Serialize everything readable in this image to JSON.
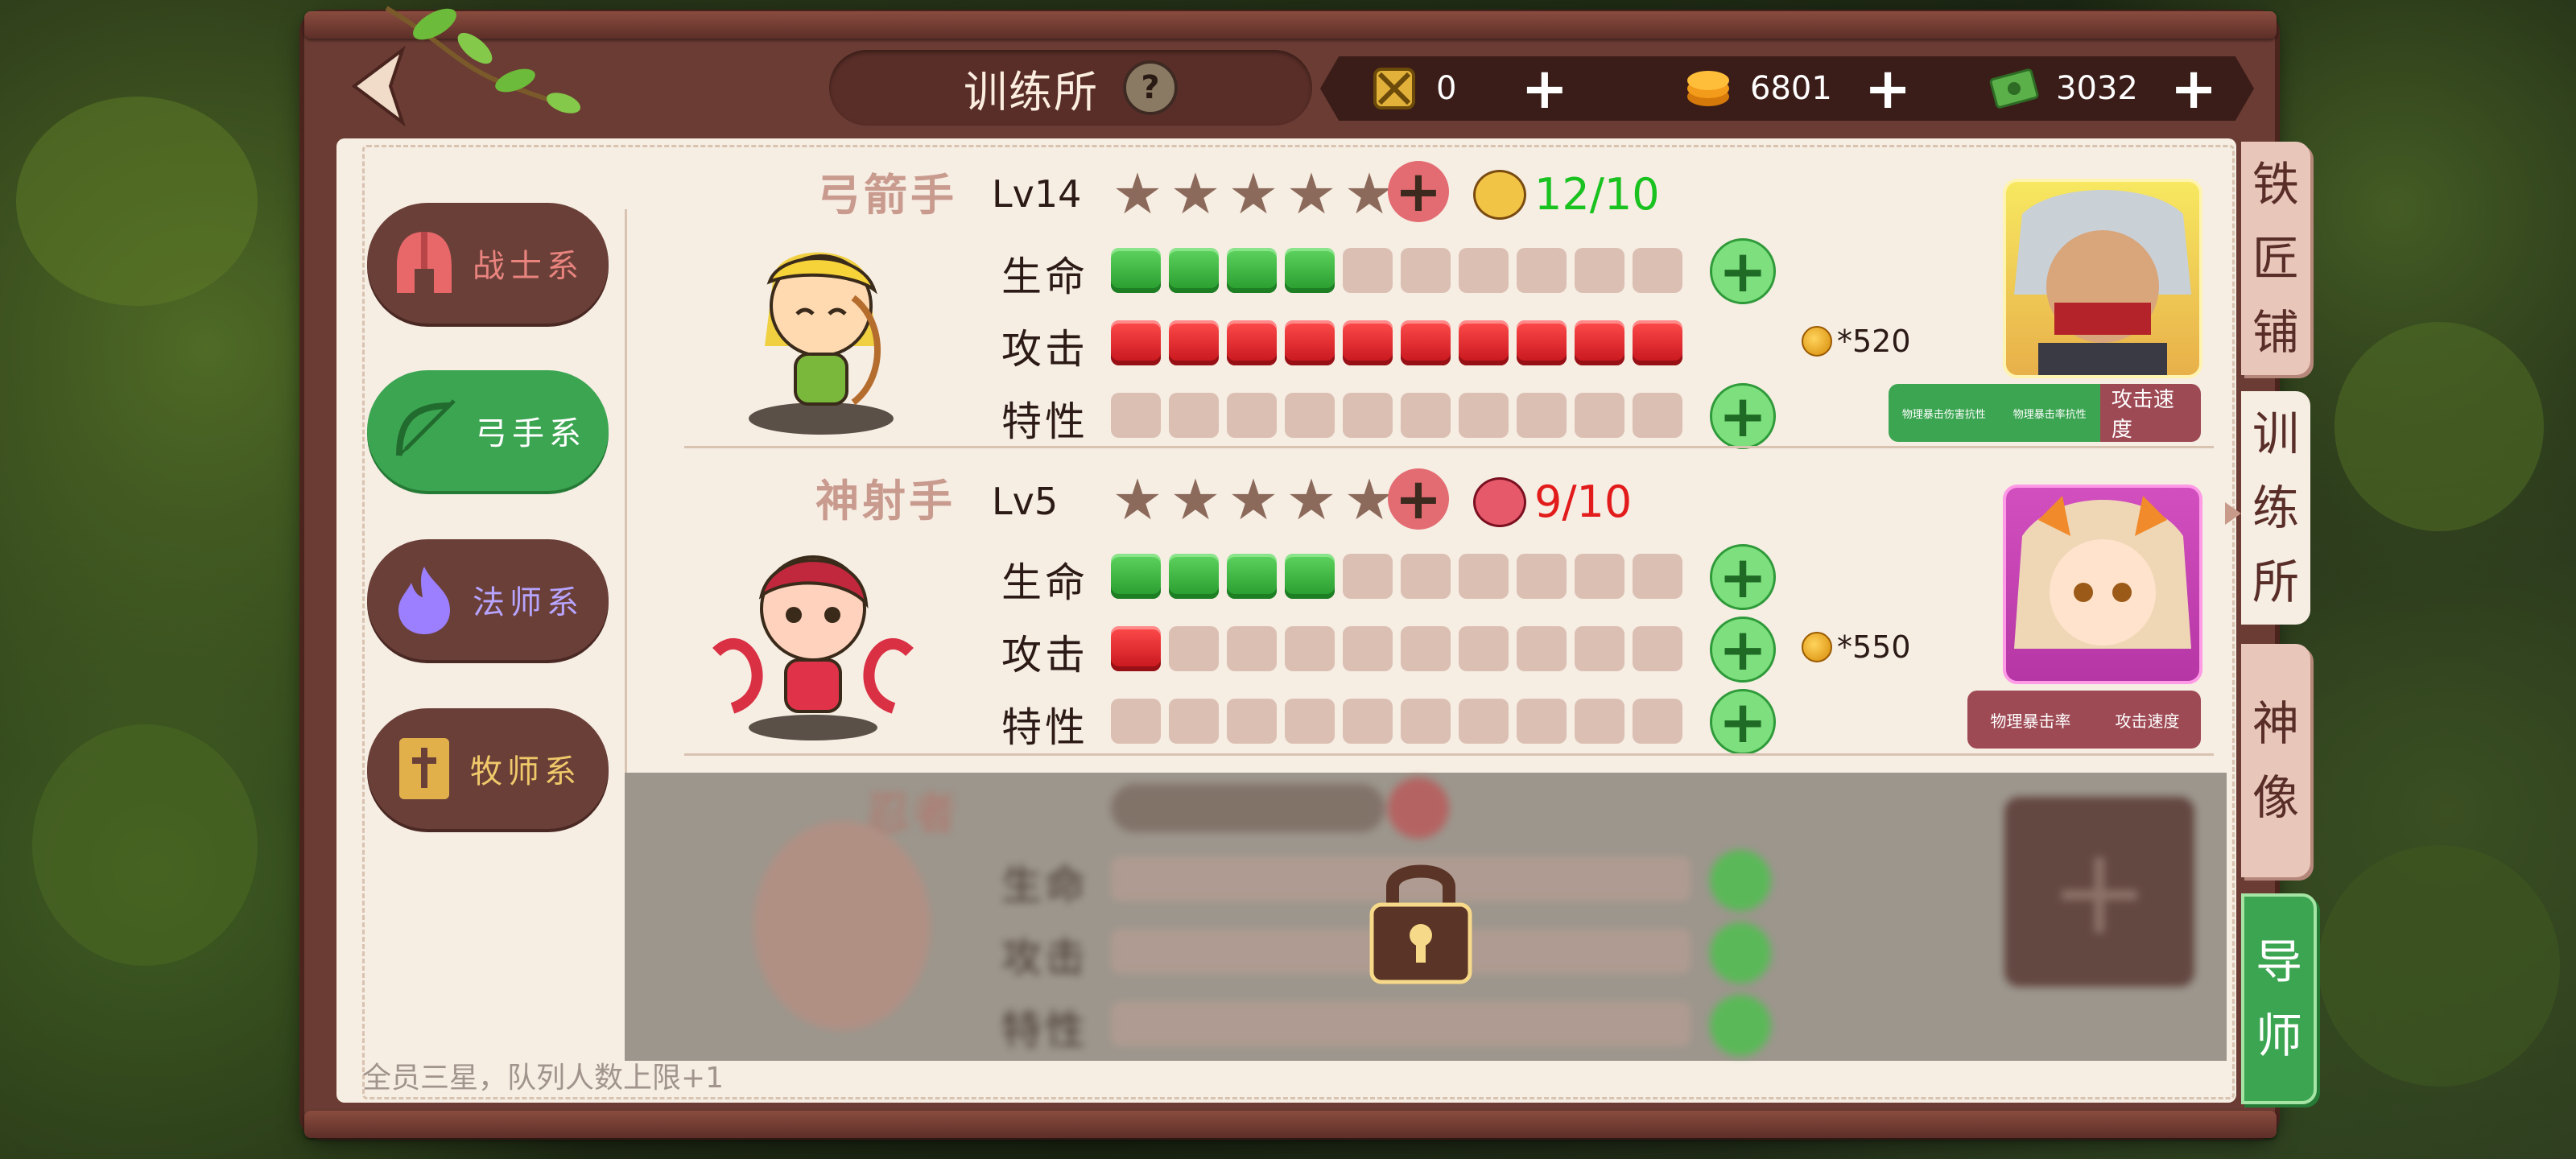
{
  "screen": {
    "title": "训练所",
    "help_label": "?"
  },
  "resources": [
    {
      "icon": "crossed-swords-icon",
      "value": "0",
      "plus": "+"
    },
    {
      "icon": "gold-coin-stack-icon",
      "value": "6801",
      "plus": "+"
    },
    {
      "icon": "cash-bill-icon",
      "value": "3032",
      "plus": "+"
    }
  ],
  "categories": [
    {
      "label": "战士系",
      "icon": "spartan-helmet-icon",
      "color": "#e8837e",
      "active": false
    },
    {
      "label": "弓手系",
      "icon": "bow-icon",
      "color": "#ffffff",
      "active": true
    },
    {
      "label": "法师系",
      "icon": "flame-icon",
      "color": "#b7a4ff",
      "active": false
    },
    {
      "label": "牧师系",
      "icon": "bible-cross-icon",
      "color": "#f0c96a",
      "active": false
    }
  ],
  "units": [
    {
      "name": "弓箭手",
      "level": "Lv14",
      "stars": 5,
      "fragments": "12/10",
      "fragments_color": "#19c21f",
      "stats": [
        {
          "label": "生命",
          "filled": 4,
          "total": 10,
          "type": "green",
          "has_plus": true
        },
        {
          "label": "攻击",
          "filled": 10,
          "total": 10,
          "type": "red",
          "has_plus": false
        },
        {
          "label": "特性",
          "filled": 0,
          "total": 10,
          "type": "none",
          "has_plus": true
        }
      ],
      "cost": "*520",
      "traits": [
        {
          "text": "物理暴击伤害抗性",
          "bg": "#3ca552"
        },
        {
          "text": "物理暴击率抗性",
          "bg": "#3ca552"
        },
        {
          "text": "攻击速度",
          "bg": "#9e4a54"
        }
      ]
    },
    {
      "name": "神射手",
      "level": "Lv5",
      "stars": 5,
      "fragments": "9/10",
      "fragments_color": "#e21b1b",
      "stats": [
        {
          "label": "生命",
          "filled": 4,
          "total": 10,
          "type": "green",
          "has_plus": true
        },
        {
          "label": "攻击",
          "filled": 1,
          "total": 10,
          "type": "red",
          "has_plus": true
        },
        {
          "label": "特性",
          "filled": 0,
          "total": 10,
          "type": "none",
          "has_plus": true
        }
      ],
      "cost": "*550",
      "traits": [
        {
          "text": "物理暴击率",
          "bg": "#9e4a54"
        },
        {
          "text": "攻击速度",
          "bg": "#9e4a54"
        }
      ]
    },
    {
      "name": "忍者",
      "locked": true,
      "stats": [
        {
          "label": "生命"
        },
        {
          "label": "攻击"
        },
        {
          "label": "特性"
        }
      ]
    }
  ],
  "footnote": "全员三星，队列人数上限+1",
  "side_tabs": [
    {
      "label": "铁匠铺",
      "state": "normal"
    },
    {
      "label": "训练所",
      "state": "active"
    },
    {
      "label": "神像",
      "state": "normal"
    },
    {
      "label": "导师",
      "state": "green"
    }
  ]
}
